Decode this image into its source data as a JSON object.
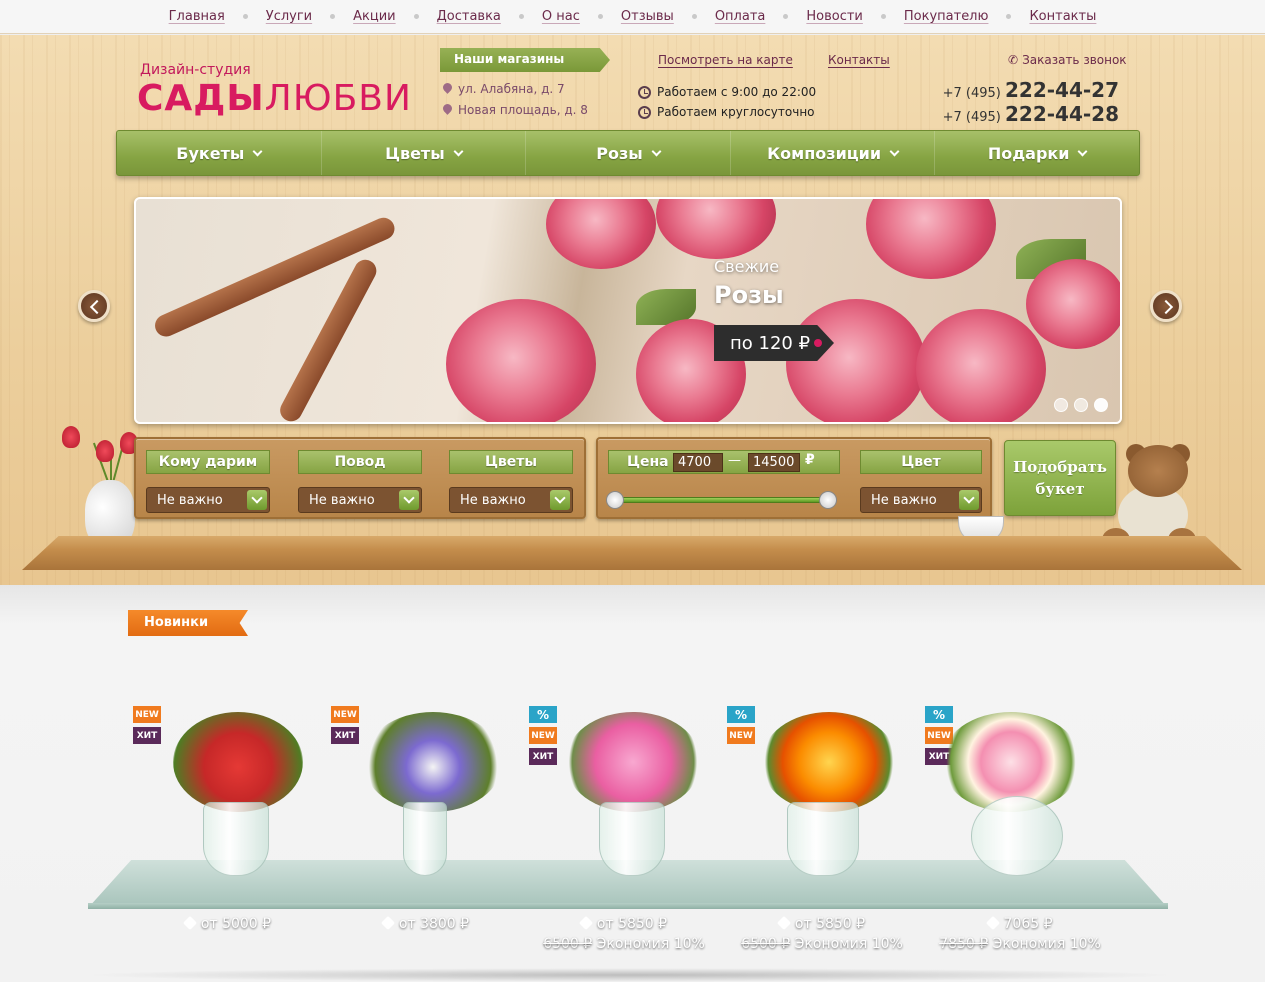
{
  "topnav": [
    "Главная",
    "Услуги",
    "Акции",
    "Доставка",
    "О нас",
    "Отзывы",
    "Оплата",
    "Новости",
    "Покупателю",
    "Контакты"
  ],
  "logo": {
    "small": "Дизайн-студия",
    "part1": "САДЫ",
    "part2": "ЛЮБВИ"
  },
  "stores": {
    "label": "Наши магазины",
    "addresses": [
      "ул. Алабяна, д. 7",
      "Новая площадь, д. 8"
    ]
  },
  "header": {
    "map_link": "Посмотреть на карте",
    "contacts_link": "Контакты",
    "hours": [
      "Работаем с 9:00 до 22:00",
      "Работаем круглосуточно"
    ],
    "callback": "Заказать звонок",
    "phones": [
      {
        "code": "+7 (495)",
        "number": "222-44-27"
      },
      {
        "code": "+7 (495)",
        "number": "222-44-28"
      }
    ]
  },
  "menu": [
    "Букеты",
    "Цветы",
    "Розы",
    "Композиции",
    "Подарки"
  ],
  "slide": {
    "line1": "Свежие",
    "line2": "Розы",
    "price": "по 120 ₽"
  },
  "filters": {
    "whom": {
      "label": "Кому дарим",
      "value": "Не важно"
    },
    "occasion": {
      "label": "Повод",
      "value": "Не важно"
    },
    "flowers": {
      "label": "Цветы",
      "value": "Не важно"
    },
    "price": {
      "label": "Цена",
      "min": "4700",
      "dash": "—",
      "max": "14500",
      "currency": "₽"
    },
    "color": {
      "label": "Цвет",
      "value": "Не важно"
    },
    "pick_button": "Подобрать букет"
  },
  "section_title": "Новинки",
  "products": [
    {
      "badges": [
        "NEW",
        "ХИТ"
      ],
      "price": "от 5000 ₽",
      "old": "",
      "save": ""
    },
    {
      "badges": [
        "NEW",
        "ХИТ"
      ],
      "price": "от 3800 ₽",
      "old": "",
      "save": ""
    },
    {
      "badges": [
        "%",
        "NEW",
        "ХИТ"
      ],
      "price": "от 5850 ₽",
      "old": "6500 ₽",
      "save": "Экономия 10%"
    },
    {
      "badges": [
        "%",
        "NEW"
      ],
      "price": "от 5850 ₽",
      "old": "6500 ₽",
      "save": "Экономия 10%"
    },
    {
      "badges": [
        "%",
        "NEW",
        "ХИТ"
      ],
      "price": "7065 ₽",
      "old": "7850 ₽",
      "save": "Экономия 10%"
    }
  ]
}
